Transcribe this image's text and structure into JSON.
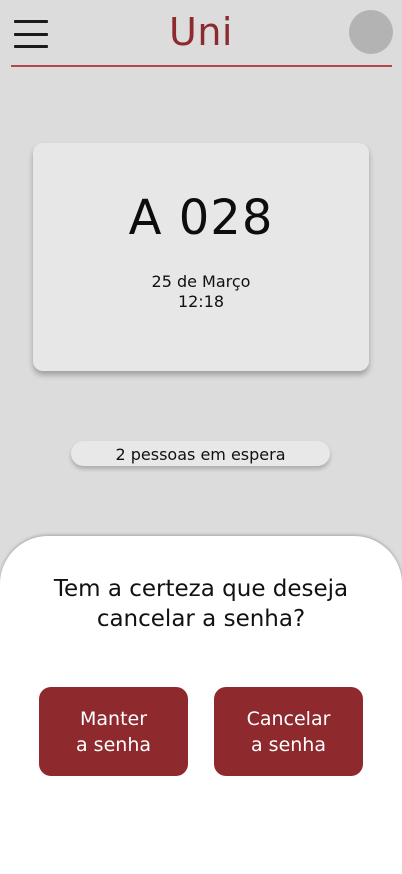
{
  "header": {
    "title": "Uni",
    "menu_icon": "hamburger-menu-icon",
    "avatar_icon": "user-avatar"
  },
  "colors": {
    "brand": "#8e2a2e",
    "background": "#dcdcdc",
    "card": "#e7e7e7",
    "sheet": "#ffffff"
  },
  "ticket": {
    "number": "A 028",
    "date": "25 de Março",
    "time": "12:18"
  },
  "queue": {
    "waiting_text": "2 pessoas em espera"
  },
  "dialog": {
    "question": "Tem a certeza que deseja cancelar a senha?",
    "keep_label": "Manter\na senha",
    "cancel_label": "Cancelar\na senha"
  }
}
